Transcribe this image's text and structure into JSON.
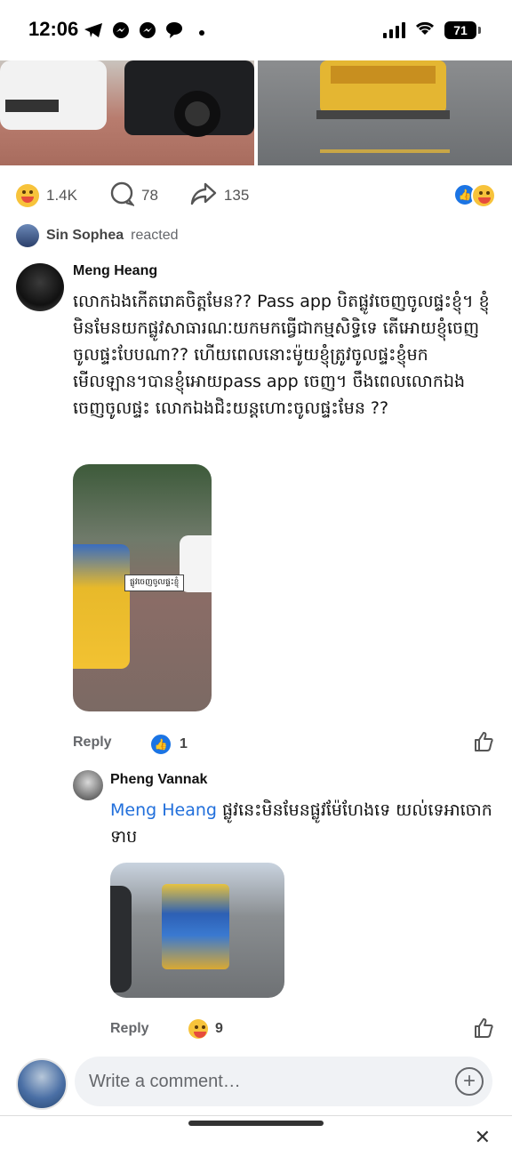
{
  "status": {
    "time": "12:06",
    "battery": "71"
  },
  "post": {
    "reactions": {
      "haha_count": "1.4K",
      "comments_count": "78",
      "shares_count": "135"
    },
    "reacted": {
      "name": "Sin Sophea",
      "suffix": "reacted"
    }
  },
  "comment": {
    "author": "Meng Heang",
    "text": "លោកឯងកើតរោគចិត្តមែន?? Pass app បិតផ្លូវចេញចូលផ្ទះខ្ញុំ។ ខ្ញុំមិនមែនយកផ្លូវសាធារណៈយកមកធ្វើជាកម្មសិទ្ធិទេ តើអោយខ្ញុំចេញចូលផ្ទះបែបណា?? ហើយពេលនោះម៉ូយខ្ញុំត្រូវចូលផ្ទះខ្ញុំមកមើលឡាន។បានខ្ញុំអោយpass app ចេញ។ ចឹងពេលលោកឯងចេញចូលផ្ទះ លោកឯងជិះយន្តហោះចូលផ្ទះមែន ??",
    "media_caption": "ផ្លូវចេញចូលផ្ទះខ្ញុំ",
    "reply_label": "Reply",
    "like_count": "1"
  },
  "reply": {
    "author": "Pheng Vannak",
    "mention": "Meng Heang",
    "text": " ផ្លូវនេះមិនមែនផ្លូវម៉ែហែងទេ យល់ទេអាចោកទាប",
    "reply_label": "Reply",
    "haha_count": "9"
  },
  "composer": {
    "placeholder": "Write a comment…"
  }
}
